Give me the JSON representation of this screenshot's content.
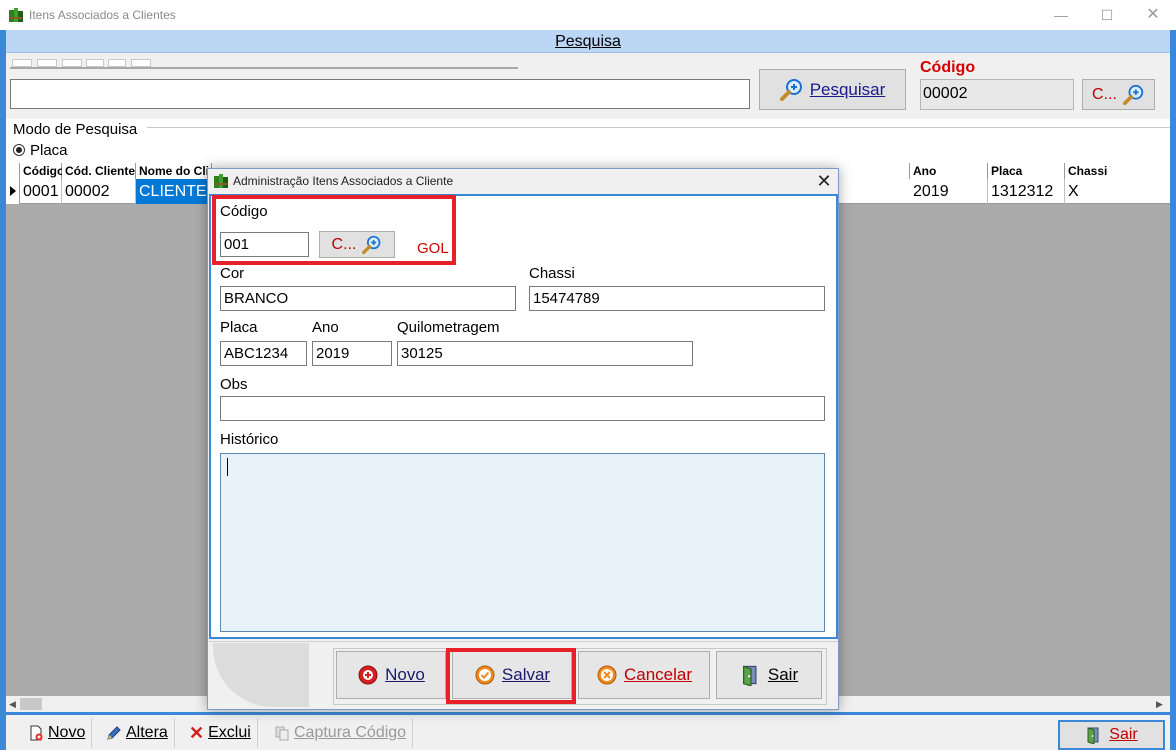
{
  "window": {
    "title": "Itens Associados a Clientes",
    "minimize": "—",
    "maximize": "☐",
    "close": "✕"
  },
  "header": {
    "title": "Pesquisa"
  },
  "search": {
    "input_value": "",
    "button_label": "Pesquisar",
    "codigo_label": "Código",
    "codigo_value": "00002",
    "codigo_button": "C..."
  },
  "mode": {
    "group_label": "Modo de Pesquisa",
    "option": "Placa"
  },
  "grid": {
    "columns": [
      "Código",
      "Cód. Cliente",
      "Nome do Cli",
      "Ano",
      "Placa",
      "Chassi"
    ],
    "row": {
      "codigo": "0001",
      "cod_cliente": "00002",
      "nome": "CLIENTE",
      "ano": "2019",
      "placa": "1312312",
      "chassi": "X"
    }
  },
  "toolbar": {
    "novo": "Novo",
    "altera": "Altera",
    "exclui": "Exclui",
    "captura": "Captura Código",
    "sair": "Sair"
  },
  "dialog": {
    "title": "Administração Itens Associados a Cliente",
    "close": "✕",
    "codigo_label": "Código",
    "codigo_value": "001",
    "codigo_button": "C...",
    "modelo": "GOL",
    "cor_label": "Cor",
    "cor_value": "BRANCO",
    "chassi_label": "Chassi",
    "chassi_value": "15474789",
    "placa_label": "Placa",
    "placa_value": "ABC1234",
    "ano_label": "Ano",
    "ano_value": "2019",
    "km_label": "Quilometragem",
    "km_value": "30125",
    "obs_label": "Obs",
    "obs_value": "",
    "historico_label": "Histórico",
    "historico_value": "",
    "buttons": {
      "novo": "Novo",
      "salvar": "Salvar",
      "cancelar": "Cancelar",
      "sair": "Sair"
    }
  },
  "colors": {
    "accent": "#3c88d8",
    "header_bg": "#bcd6f6",
    "highlight": "#e8202a",
    "label_red": "#d40000",
    "selection": "#0078d7"
  }
}
